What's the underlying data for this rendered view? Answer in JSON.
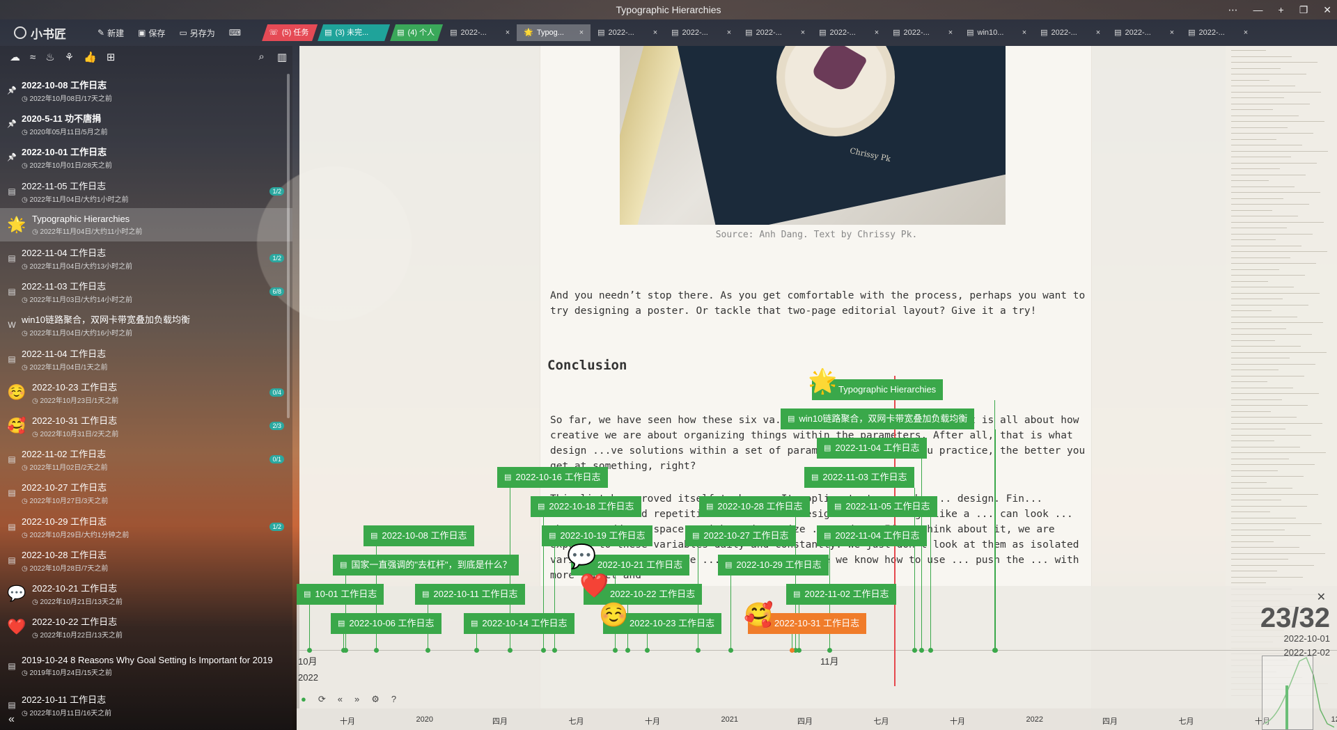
{
  "app": {
    "window_title": "Typographic Hierarchies",
    "logo_text": "小书匠",
    "window_controls": [
      "⋯",
      "—",
      "+",
      "❐",
      "✕"
    ]
  },
  "toolbar": {
    "new_label": "新建",
    "save_label": "保存",
    "save_as_label": "另存为"
  },
  "tabs": [
    {
      "label": "(5) 任务",
      "style": "red"
    },
    {
      "label": "(3) 未完...",
      "style": "teal"
    },
    {
      "label": "(4) 个人",
      "style": "green"
    },
    {
      "label": "2022-...",
      "style": "plain"
    },
    {
      "label": "Typog...",
      "style": "active"
    },
    {
      "label": "2022-...",
      "style": "plain"
    },
    {
      "label": "2022-...",
      "style": "plain"
    },
    {
      "label": "2022-...",
      "style": "plain"
    },
    {
      "label": "2022-...",
      "style": "plain"
    },
    {
      "label": "2022-...",
      "style": "plain"
    },
    {
      "label": "win10...",
      "style": "plain"
    },
    {
      "label": "2022-...",
      "style": "plain"
    },
    {
      "label": "2022-...",
      "style": "plain"
    },
    {
      "label": "2022-...",
      "style": "plain"
    }
  ],
  "sidebar": {
    "notes": [
      {
        "title": "2022-10-08 工作日志",
        "sub": "2022年10月08日/17天之前",
        "pinned": true,
        "icon": "pin-icon"
      },
      {
        "title": "2020-5-11 功不唐捐",
        "sub": "2020年05月11日/5月之前",
        "pinned": true,
        "icon": "pin-icon"
      },
      {
        "title": "2022-10-01 工作日志",
        "sub": "2022年10月01日/28天之前",
        "pinned": true,
        "icon": "pin-icon"
      },
      {
        "title": "2022-11-05 工作日志",
        "sub": "2022年11月04日/大约1小时之前",
        "badge": "1/2",
        "icon": "doc-icon"
      },
      {
        "title": "Typographic Hierarchies",
        "sub": "2022年11月04日/大约11小时之前",
        "active": true,
        "emoji": "🌟"
      },
      {
        "title": "2022-11-04 工作日志",
        "sub": "2022年11月04日/大约13小时之前",
        "badge": "1/2",
        "icon": "doc-icon"
      },
      {
        "title": "2022-11-03 工作日志",
        "sub": "2022年11月03日/大约14小时之前",
        "badge": "6/8",
        "icon": "doc-icon"
      },
      {
        "title": "win10链路聚合，双网卡带宽叠加负载均衡",
        "sub": "2022年11月04日/大约16小时之前",
        "icon": "w-icon"
      },
      {
        "title": "2022-11-04 工作日志",
        "sub": "2022年11月04日/1天之前",
        "icon": "doc-icon"
      },
      {
        "title": "2022-10-23 工作日志",
        "sub": "2022年10月23日/1天之前",
        "badge": "0/4",
        "emoji": "☺️"
      },
      {
        "title": "2022-10-31 工作日志",
        "sub": "2022年10月31日/2天之前",
        "badge": "2/3",
        "emoji": "🥰"
      },
      {
        "title": "2022-11-02 工作日志",
        "sub": "2022年11月02日/2天之前",
        "badge": "0/1",
        "icon": "doc-icon"
      },
      {
        "title": "2022-10-27 工作日志",
        "sub": "2022年10月27日/3天之前",
        "icon": "doc-icon"
      },
      {
        "title": "2022-10-29 工作日志",
        "sub": "2022年10月29日/大约1分钟之前",
        "badge": "1/2",
        "icon": "doc-icon"
      },
      {
        "title": "2022-10-28 工作日志",
        "sub": "2022年10月28日/7天之前",
        "icon": "doc-icon"
      },
      {
        "title": "2022-10-21 工作日志",
        "sub": "2022年10月21日/13天之前",
        "emoji": "💬"
      },
      {
        "title": "2022-10-22 工作日志",
        "sub": "2022年10月22日/13天之前",
        "emoji": "❤️"
      },
      {
        "title": "2019-10-24 8 Reasons Why Goal Setting Is Important for 2019",
        "sub": "2019年10月24日/15天之前",
        "icon": "doc-icon",
        "tall": true
      },
      {
        "title": "2022-10-11 工作日志",
        "sub": "2022年10月11日/16天之前",
        "icon": "doc-icon"
      }
    ]
  },
  "article": {
    "caption": "Source: Anh Dang. Text by Chrissy Pk.",
    "photo_signature": "Chrissy Pk",
    "para1": "And you needn’t stop there. As you get comfortable with the process, perhaps you want to try designing a poster. Or tackle that two-page editorial layout? Give it a try!",
    "heading": "Conclusion",
    "para2": "So far, we have seen how these six va... the content in any format. It is all about how creative we are about organizing things within the parameters. After all, that is what design ...ve solutions within a set of parameters. The more you practice, the better you get at something, right?",
    "para3": "This list has proved itself to be ... It applies to typography ... design. Fin... contrast ... and repetition. Take ... to design ... all things like a ... can look ... when you add ... space, weight, size, size ... and ... If we think about it, we are exposed to these variables daily and constantly. We just don’t look at them as isolated variables ... the entire ... they do. And once we know how to use ... push the ... with more impact and"
  },
  "timeline": {
    "counter": "23/32",
    "range_start": "2022-10-01",
    "range_end": "2022-12-02",
    "axis_month_left": "10月",
    "axis_year": "2022",
    "axis_month_right": "11月",
    "events": [
      {
        "label": "Typographic Hierarchies",
        "emoji": "🌟"
      },
      {
        "label": "win10链路聚合，双网卡带宽叠加负载均衡"
      },
      {
        "label": "2022-11-04 工作日志"
      },
      {
        "label": "2022-10-16 工作日志"
      },
      {
        "label": "2022-11-03 工作日志"
      },
      {
        "label": "2022-10-18 工作日志"
      },
      {
        "label": "2022-10-28 工作日志"
      },
      {
        "label": "2022-11-05 工作日志"
      },
      {
        "label": "2022-10-08 工作日志"
      },
      {
        "label": "2022-10-19 工作日志"
      },
      {
        "label": "2022-10-27 工作日志"
      },
      {
        "label": "2022-11-04 工作日志"
      },
      {
        "label": "国家一直强调的\"去杠杆\"，到底是什么？"
      },
      {
        "label": "2022-10-21 工作日志",
        "emoji": "💬"
      },
      {
        "label": "2022-10-29 工作日志"
      },
      {
        "label": "10-01 工作日志"
      },
      {
        "label": "2022-10-11 工作日志"
      },
      {
        "label": "2022-10-22 工作日志",
        "emoji": "❤️"
      },
      {
        "label": "2022-11-02 工作日志"
      },
      {
        "label": "2022-10-06 工作日志"
      },
      {
        "label": "2022-10-14 工作日志"
      },
      {
        "label": "2022-10-23 工作日志",
        "emoji": "☺️"
      },
      {
        "label": "2022-10-31 工作日志",
        "emoji": "🥰",
        "highlight": true
      }
    ],
    "overview_labels": [
      "十月",
      "2020",
      "四月",
      "七月",
      "十月",
      "2021",
      "四月",
      "七月",
      "十月",
      "2022",
      "四月",
      "七月",
      "十月",
      "12"
    ]
  }
}
